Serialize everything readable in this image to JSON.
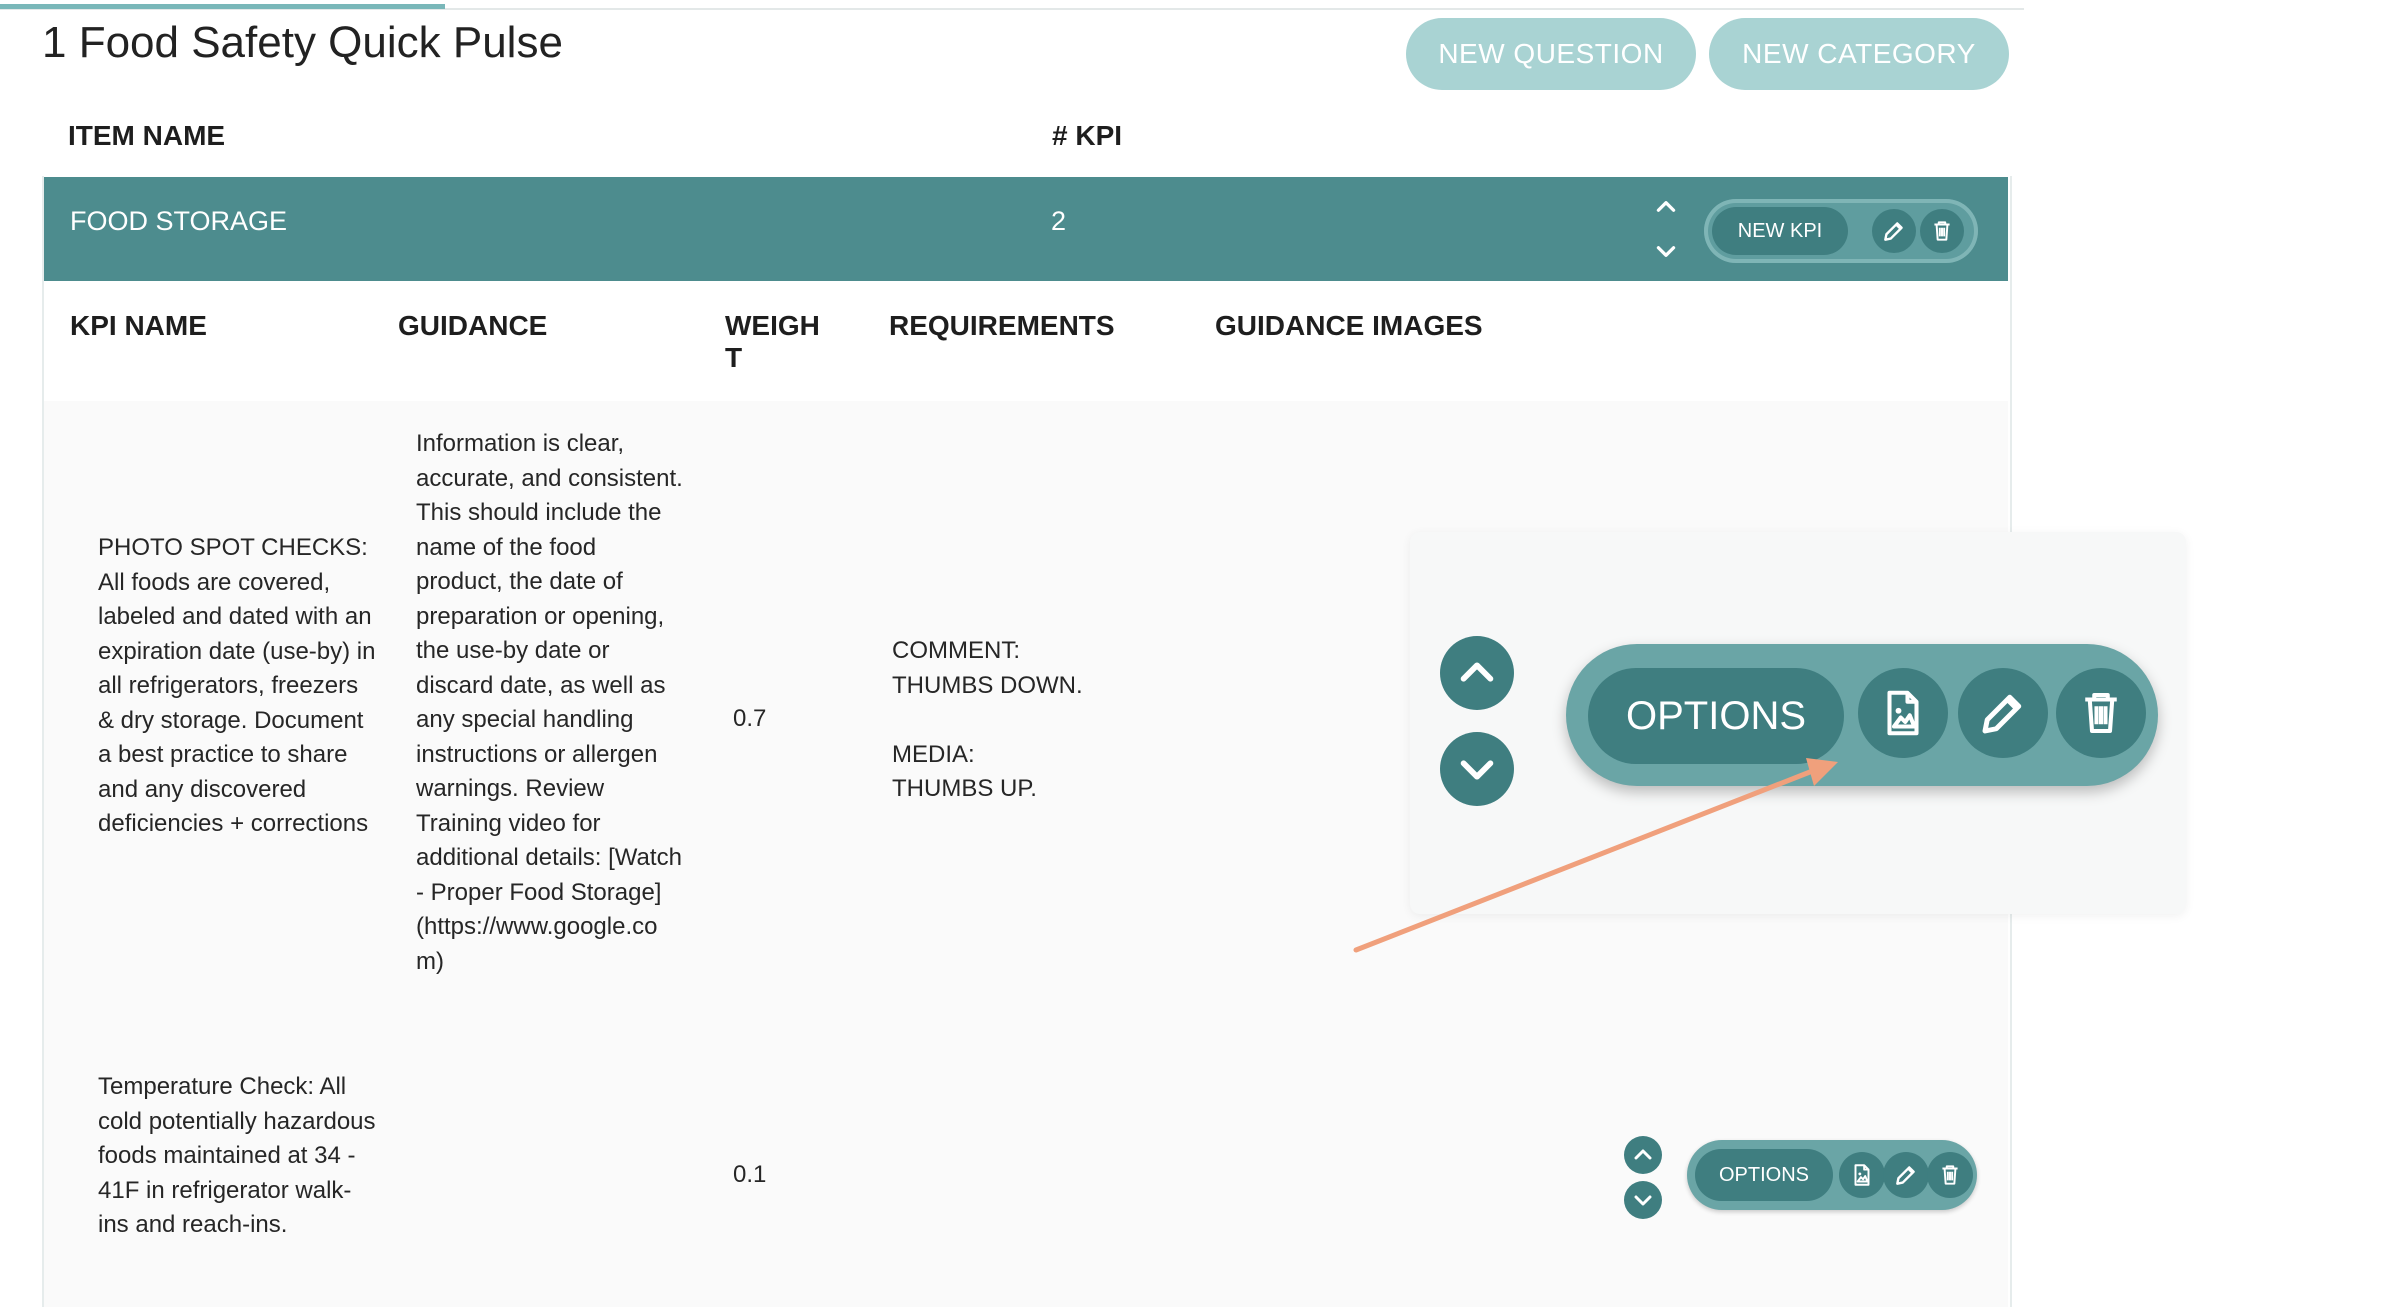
{
  "header": {
    "title": "1 Food Safety Quick Pulse",
    "new_question_label": "NEW QUESTION",
    "new_category_label": "NEW CATEGORY"
  },
  "items_table": {
    "columns": [
      "ITEM NAME",
      "# KPI"
    ]
  },
  "category": {
    "name": "FOOD STORAGE",
    "kpi_count": "2",
    "new_kpi_label": "NEW KPI"
  },
  "kpi_table": {
    "columns": [
      "KPI NAME",
      "GUIDANCE",
      "WEIGH\nT",
      "REQUIREMENTS",
      "GUIDANCE IMAGES"
    ],
    "rows": [
      {
        "name": "PHOTO SPOT CHECKS: All foods are covered, labeled and dated with an expiration date (use-by) in all refrigerators, freezers & dry storage. Document a best practice to share and any discovered deficiencies + corrections",
        "guidance": "Information is clear, accurate, and consistent. This should include the name of the food product, the date of preparation or opening, the use-by date or discard date, as well as any special handling instructions or allergen warnings. Review Training video for additional details: [Watch - Proper Food Storage] (https://www.google.co m)",
        "weight": "0.7",
        "requirements": "COMMENT:\nTHUMBS DOWN.\n\nMEDIA:\nTHUMBS UP.",
        "guidance_images": ""
      },
      {
        "name": "Temperature Check: All cold potentially hazardous foods maintained at 34 - 41F in refrigerator walk-ins and reach-ins.",
        "guidance": "",
        "weight": "0.1",
        "requirements": "",
        "guidance_images": ""
      }
    ]
  },
  "actions": {
    "options_label": "OPTIONS"
  },
  "colors": {
    "teal_dark": "#3f7e80",
    "teal_header": "#4d8c8e",
    "teal_light": "#a9d3d3",
    "arrow": "#f0a07c"
  }
}
